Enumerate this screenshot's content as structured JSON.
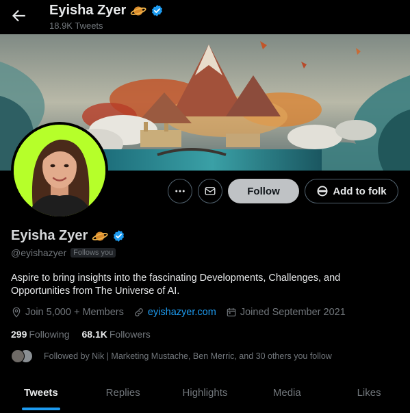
{
  "header": {
    "name": "Eyisha Zyer",
    "tweet_count": "18.9K Tweets"
  },
  "icons": {
    "back": "arrow-left-icon",
    "planet": "ringed-planet-emoji",
    "verified": "verified-badge-icon",
    "more": "more-dots-icon",
    "message": "envelope-icon",
    "folk": "folk-icon",
    "location": "location-pin-icon",
    "link": "link-icon",
    "calendar": "calendar-icon"
  },
  "actions": {
    "follow_label": "Follow",
    "add_to_folk_label": "Add to folk"
  },
  "profile": {
    "name": "Eyisha Zyer",
    "handle": "@eyishazyer",
    "follows_you": "Follows you",
    "bio": "Aspire to bring insights into the fascinating Developments, Challenges, and Opportunities from The Universe of AI.",
    "location": "Join 5,000 + Members",
    "website": "eyishazyer.com",
    "joined": "Joined September 2021",
    "following_count": "299",
    "following_label": "Following",
    "followers_count": "68.1K",
    "followers_label": "Followers",
    "followed_by": "Followed by Nik | Marketing Mustache, Ben Merric, and 30 others you follow"
  },
  "tabs": [
    {
      "label": "Tweets",
      "active": true
    },
    {
      "label": "Replies",
      "active": false
    },
    {
      "label": "Highlights",
      "active": false
    },
    {
      "label": "Media",
      "active": false
    },
    {
      "label": "Likes",
      "active": false
    }
  ],
  "colors": {
    "accent": "#1d9bf0",
    "follow_button": "#bfc2c5",
    "avatar_background": "#b6ff2a",
    "verified": "#1d9bf0"
  }
}
